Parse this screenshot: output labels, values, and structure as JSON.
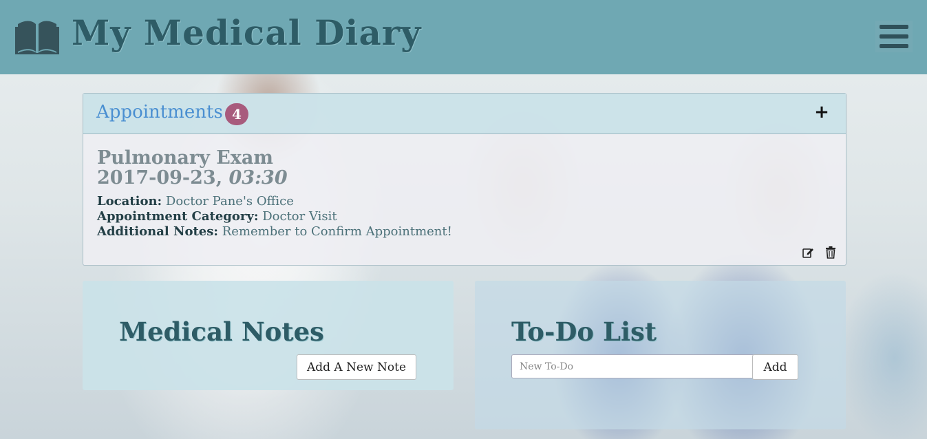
{
  "header": {
    "title": "My Medical Diary",
    "logo_icon": "open-book-icon",
    "menu_icon": "hamburger-icon"
  },
  "appointments": {
    "title": "Appointments",
    "count": "4",
    "add_label": "+",
    "items": [
      {
        "name": "Pulmonary Exam",
        "date": "2017-09-23,",
        "time": "03:30",
        "location_label": "Location:",
        "location": "Doctor Pane's Office",
        "category_label": "Appointment Category:",
        "category": "Doctor Visit",
        "notes_label": "Additional Notes:",
        "notes": "Remember to Confirm Appointment!",
        "edit_icon": "edit-icon",
        "delete_icon": "trash-icon"
      }
    ]
  },
  "notes": {
    "title": "Medical Notes",
    "add_label": "Add A New Note"
  },
  "todo": {
    "title": "To-Do List",
    "input_placeholder": "New To-Do",
    "add_label": "Add"
  },
  "colors": {
    "header_bg": "#6fa8b3",
    "title_text": "#2e5c66",
    "appointments_title": "#4a8fd1",
    "badge": "#a85b7d"
  }
}
